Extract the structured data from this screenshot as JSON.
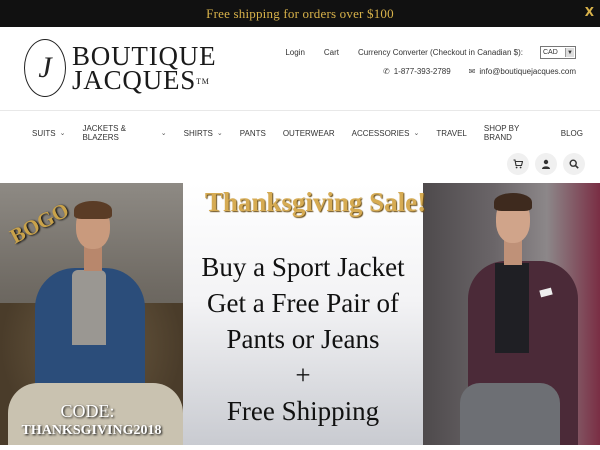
{
  "promo": {
    "text": "Free shipping for orders over $100",
    "close_label": "X"
  },
  "brand": {
    "line1": "BOUTIQUE",
    "line2": "JACQUES",
    "trademark": "TM",
    "crest_letter": "J"
  },
  "utility": {
    "login": "Login",
    "cart": "Cart",
    "currency_label": "Currency Converter (Checkout in Canadian $):",
    "currency_value": "CAD"
  },
  "contact": {
    "phone": "1-877-393-2789",
    "email": "info@boutiquejacques.com",
    "phone_icon": "phone-icon",
    "email_icon": "envelope-icon"
  },
  "nav": {
    "items": [
      {
        "label": "SUITS",
        "dropdown": true
      },
      {
        "label": "JACKETS & BLAZERS",
        "dropdown": true
      },
      {
        "label": "SHIRTS",
        "dropdown": true
      },
      {
        "label": "PANTS",
        "dropdown": false
      },
      {
        "label": "OUTERWEAR",
        "dropdown": false
      },
      {
        "label": "ACCESSORIES",
        "dropdown": true
      },
      {
        "label": "TRAVEL",
        "dropdown": false
      },
      {
        "label": "SHOP BY BRAND",
        "dropdown": false
      },
      {
        "label": "BLOG",
        "dropdown": false
      }
    ]
  },
  "header_icons": [
    "cart-icon",
    "user-icon",
    "search-icon"
  ],
  "hero": {
    "badge": "BOGO",
    "title": "Thanksgiving Sale!",
    "offer_line1": "Buy a Sport Jacket",
    "offer_line2": "Get a Free Pair of",
    "offer_line3": "Pants or Jeans",
    "offer_plus": "+",
    "offer_line5": "Free Shipping",
    "code_label": "CODE:",
    "code_value": "THANKSGIVING2018"
  },
  "colors": {
    "promo_bg": "#111111",
    "promo_text": "#d8b24a",
    "gold": "#d6ab53"
  }
}
